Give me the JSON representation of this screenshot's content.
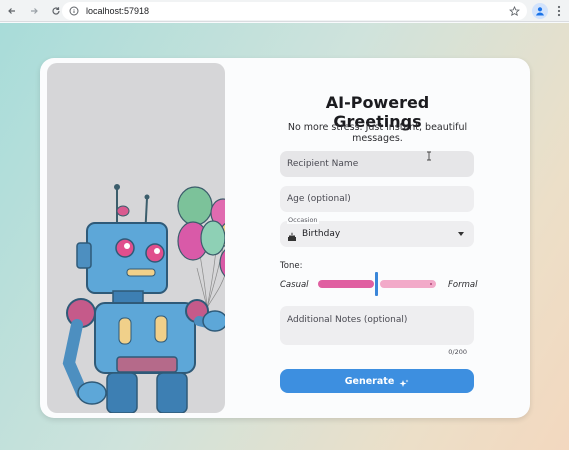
{
  "browser": {
    "url": "localhost:57918"
  },
  "card": {
    "title": "AI-Powered Greetings",
    "subtitle": "No more stress. Just instant, beautiful messages."
  },
  "form": {
    "recipient_placeholder": "Recipient Name",
    "age_placeholder": "Age (optional)",
    "occasion": {
      "label": "Occasion",
      "value": "Birthday",
      "icon": "cake-icon"
    },
    "tone": {
      "label": "Tone:",
      "min_label": "Casual",
      "max_label": "Formal",
      "value": 0.5
    },
    "notes_placeholder": "Additional Notes (optional)",
    "notes_counter": "0/200",
    "generate_label": "Generate",
    "generate_icon": "sparkles-icon"
  },
  "colors": {
    "accent": "#3d8fe0",
    "slider_active": "#e05fa1",
    "slider_inactive": "#f2aac9"
  }
}
